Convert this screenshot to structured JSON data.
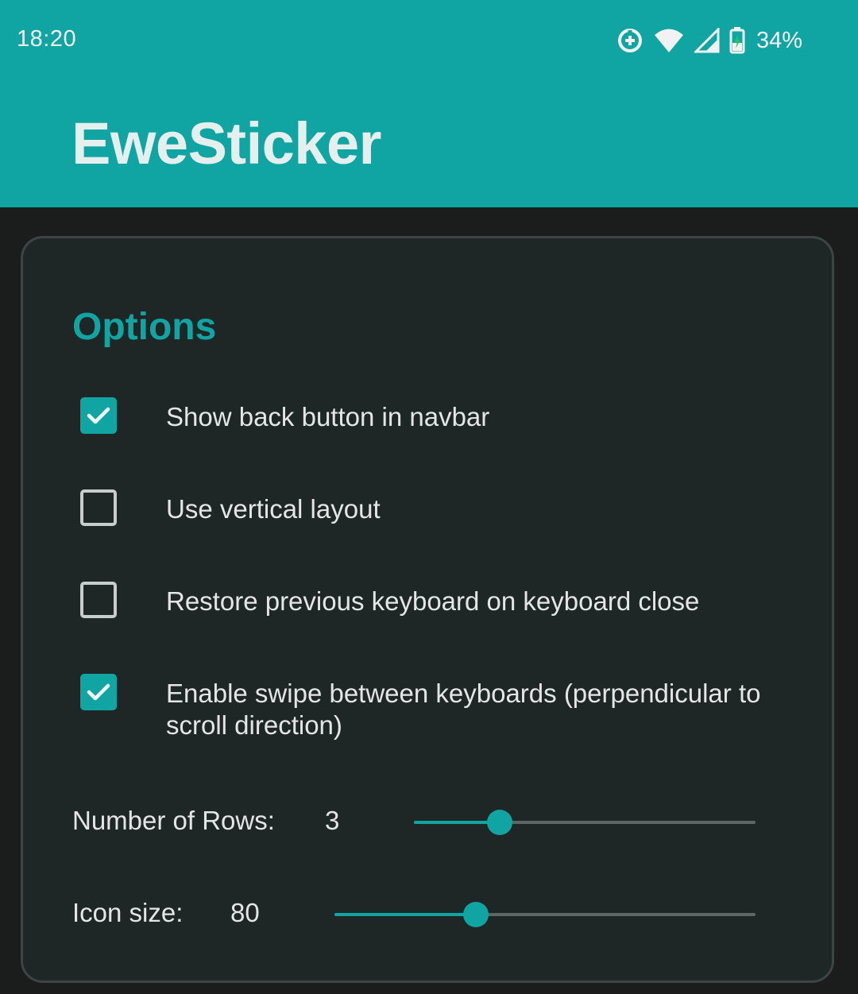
{
  "status_bar": {
    "time": "18:20",
    "battery_percent": "34%",
    "icons": [
      "data-saver-icon",
      "wifi-icon",
      "cell-signal-icon",
      "battery-charging-icon"
    ]
  },
  "app_bar": {
    "title": "EweSticker"
  },
  "options": {
    "title": "Options",
    "items": [
      {
        "label": "Show back button in navbar",
        "checked": true
      },
      {
        "label": "Use vertical layout",
        "checked": false
      },
      {
        "label": "Restore previous keyboard on keyboard close",
        "checked": false
      },
      {
        "label": "Enable swipe between keyboards (perpendicular to scroll direction)",
        "checked": true
      }
    ]
  },
  "sliders": {
    "rows": {
      "label": "Number of Rows:",
      "value": "3",
      "fraction": 0.25
    },
    "icon_size": {
      "label": "Icon size:",
      "value": "80",
      "fraction": 0.335
    }
  },
  "colors": {
    "accent": "#10a5a3",
    "background": "#1b1c1c",
    "card": "#1f2626",
    "text": "#e4e6e5"
  }
}
